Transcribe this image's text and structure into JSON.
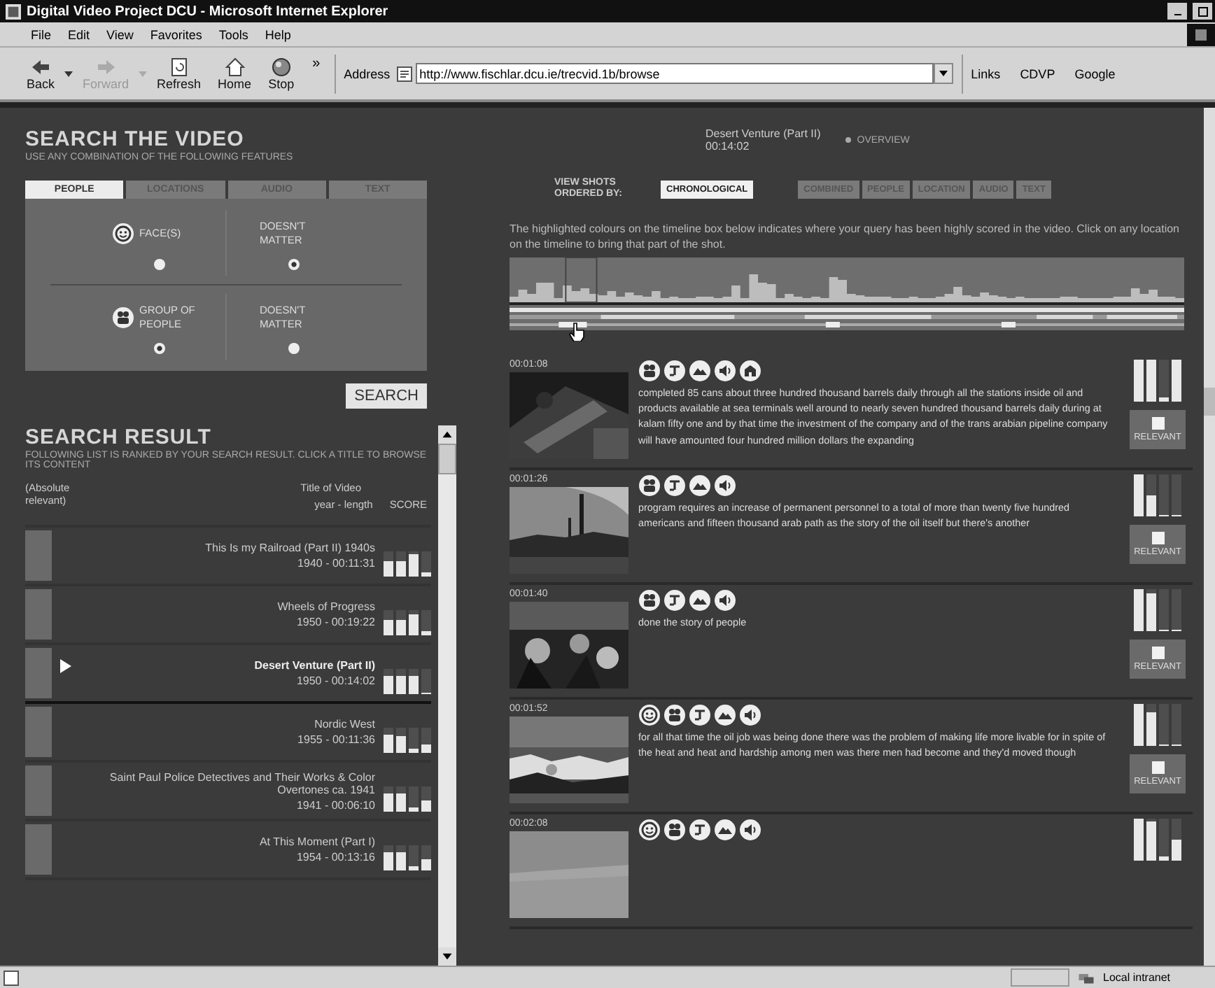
{
  "window": {
    "title": "Digital Video Project DCU - Microsoft Internet Explorer"
  },
  "menu": [
    "File",
    "Edit",
    "View",
    "Favorites",
    "Tools",
    "Help"
  ],
  "toolbar": [
    {
      "kind": "back",
      "label": "Back",
      "disabled": false
    },
    {
      "kind": "forward",
      "label": "Forward",
      "disabled": true
    },
    {
      "kind": "refresh",
      "label": "Refresh",
      "disabled": false
    },
    {
      "kind": "home",
      "label": "Home",
      "disabled": false
    },
    {
      "kind": "stop",
      "label": "Stop",
      "disabled": false
    }
  ],
  "more": "»",
  "address": {
    "label": "Address",
    "value": "http://www.fischlar.dcu.ie/trecvid.1b/browse"
  },
  "links": {
    "label": "Links",
    "items": [
      "CDVP",
      "Google"
    ]
  },
  "search": {
    "title": "SEARCH THE VIDEO",
    "subtitle": "USE ANY COMBINATION OF THE FOLLOWING FEATURES",
    "tabs": [
      {
        "label": "PEOPLE",
        "selected": true
      },
      {
        "label": "LOCATIONS",
        "selected": false
      },
      {
        "label": "AUDIO",
        "selected": false
      },
      {
        "label": "TEXT",
        "selected": false
      }
    ],
    "rows": [
      {
        "kind": "face",
        "choices": [
          {
            "label": "FACE(S)",
            "selected": false
          },
          {
            "label": "DOESN'T MATTER",
            "selected": true
          }
        ]
      },
      {
        "kind": "group",
        "choices": [
          {
            "label": "GROUP OF PEOPLE",
            "selected": true
          },
          {
            "label": "DOESN'T MATTER",
            "selected": false
          }
        ]
      }
    ],
    "button": "SEARCH"
  },
  "results": {
    "title": "SEARCH RESULT",
    "subtitle": "FOLLOWING LIST IS RANKED BY YOUR SEARCH RESULT. CLICK A TITLE TO BROWSE ITS CONTENT",
    "relevance_heading": "(Absolute relevant)",
    "title_heading": "Title of Video",
    "meta_heading": "year - length",
    "score_heading": "SCORE",
    "items": [
      {
        "title": "This Is my Railroad (Part II) 1940s",
        "meta": "1940 - 00:11:31",
        "selected": false,
        "scores": [
          {
            "level": 0.6
          },
          {
            "level": 0.6
          },
          {
            "level": 0.9
          },
          {
            "level": 0.15
          }
        ]
      },
      {
        "title": "Wheels of Progress",
        "meta": "1950 - 00:19:22",
        "selected": false,
        "scores": [
          {
            "level": 0.6
          },
          {
            "level": 0.6
          },
          {
            "level": 0.85
          },
          {
            "level": 0.15
          }
        ]
      },
      {
        "title": "Desert Venture (Part II)",
        "meta": "1950 - 00:14:02",
        "selected": true,
        "scores": [
          {
            "level": 0.7
          },
          {
            "level": 0.7
          },
          {
            "level": 0.7
          },
          {
            "level": 0.05
          }
        ]
      },
      {
        "title": "Nordic West",
        "meta": "1955 - 00:11:36",
        "selected": false,
        "scores": [
          {
            "level": 0.75
          },
          {
            "level": 0.65
          },
          {
            "level": 0.15
          },
          {
            "level": 0.35
          }
        ]
      },
      {
        "title": "Saint Paul Police Detectives and Their Works & Color Overtones ca. 1941",
        "meta": "1941 - 00:06:10",
        "selected": false,
        "scores": [
          {
            "level": 0.75
          },
          {
            "level": 0.7
          },
          {
            "level": 0.15
          },
          {
            "level": 0.45
          }
        ]
      },
      {
        "title": "At This Moment (Part I)",
        "meta": "1954 - 00:13:16",
        "selected": false,
        "scores": [
          {
            "level": 0.75
          },
          {
            "level": 0.7
          },
          {
            "level": 0.15
          },
          {
            "level": 0.45
          }
        ]
      }
    ]
  },
  "video": {
    "title": "Desert Venture (Part II)",
    "duration": "00:14:02",
    "overview": "OVERVIEW"
  },
  "order": {
    "label": "VIEW SHOTS ORDERED BY:",
    "buttons": [
      {
        "label": "CHRONOLOGICAL",
        "selected": true
      },
      {
        "label": "COMBINED",
        "selected": false
      },
      {
        "label": "PEOPLE",
        "selected": false
      },
      {
        "label": "LOCATION",
        "selected": false
      },
      {
        "label": "AUDIO",
        "selected": false
      },
      {
        "label": "TEXT",
        "selected": false
      }
    ]
  },
  "timeline_hint": "The highlighted colours on the timeline box below indicates where your query has been highly scored in the video. Click on any location on the timeline to bring that part of the shot.",
  "shots": [
    {
      "time": "00:01:08",
      "features": [
        {
          "kind": "group"
        },
        {
          "kind": "text"
        },
        {
          "kind": "landscape"
        },
        {
          "kind": "audio"
        },
        {
          "kind": "building"
        }
      ],
      "transcript": "completed 85 cans about three hundred thousand barrels daily through all the stations inside oil and products available at sea terminals well around to nearly seven hundred thousand barrels daily during at kalam fifty one and by that time the investment of the company and of the trans arabian pipeline company will have amounted four hundred million dollars the expanding",
      "scores": [
        {
          "level": 1
        },
        {
          "level": 1
        },
        {
          "level": 0.1
        },
        {
          "level": 1
        }
      ],
      "relevant": {
        "label": "RELEVANT",
        "checked": false
      }
    },
    {
      "time": "00:01:26",
      "features": [
        {
          "kind": "group"
        },
        {
          "kind": "text"
        },
        {
          "kind": "landscape"
        },
        {
          "kind": "audio"
        }
      ],
      "transcript": "program requires an increase of permanent personnel to a total of more than twenty five hundred americans and fifteen thousand arab path as the story of the oil itself but there's another",
      "scores": [
        {
          "level": 1
        },
        {
          "level": 0.5
        },
        {
          "level": 0.05
        },
        {
          "level": 0.05
        }
      ],
      "relevant": {
        "label": "RELEVANT",
        "checked": false
      }
    },
    {
      "time": "00:01:40",
      "features": [
        {
          "kind": "group"
        },
        {
          "kind": "text"
        },
        {
          "kind": "landscape"
        },
        {
          "kind": "audio"
        }
      ],
      "transcript": "done the story of people",
      "scores": [
        {
          "level": 1
        },
        {
          "level": 0.9
        },
        {
          "level": 0.05
        },
        {
          "level": 0.05
        }
      ],
      "relevant": {
        "label": "RELEVANT",
        "checked": false
      }
    },
    {
      "time": "00:01:52",
      "features": [
        {
          "kind": "face"
        },
        {
          "kind": "group"
        },
        {
          "kind": "text"
        },
        {
          "kind": "landscape"
        },
        {
          "kind": "audio"
        }
      ],
      "transcript": "for all that time the oil job was being done there was the problem of making life more livable for in spite of the heat and heat and hardship among men was there men had become and they'd moved though",
      "scores": [
        {
          "level": 1
        },
        {
          "level": 0.8
        },
        {
          "level": 0.05
        },
        {
          "level": 0.05
        }
      ],
      "relevant": {
        "label": "RELEVANT",
        "checked": false
      }
    },
    {
      "time": "00:02:08",
      "features": [
        {
          "kind": "face"
        },
        {
          "kind": "group"
        },
        {
          "kind": "text"
        },
        {
          "kind": "landscape"
        },
        {
          "kind": "audio"
        }
      ],
      "scores": [
        {
          "level": 1
        },
        {
          "level": 0.95
        },
        {
          "level": 0.1
        },
        {
          "level": 0.5
        }
      ]
    }
  ],
  "status": {
    "zone": "Local intranet"
  }
}
